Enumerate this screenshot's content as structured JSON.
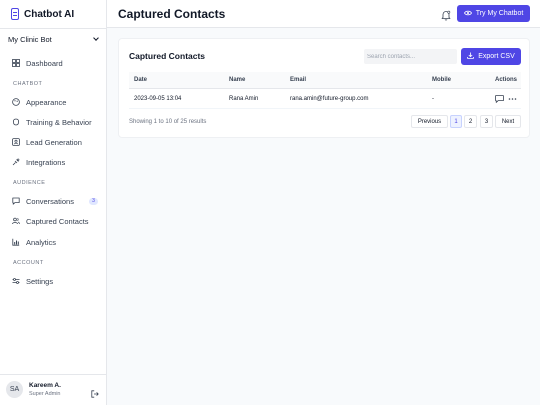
{
  "app": {
    "name": "Chatbot AI"
  },
  "bot_selector": {
    "value": "My Clinic Bot"
  },
  "sidebar": {
    "dashboard": "Dashboard",
    "section_chatbot": "CHATBOT",
    "appearance": "Appearance",
    "training": "Training & Behavior",
    "lead_generation": "Lead Generation",
    "integrations": "Integrations",
    "section_audience": "AUDIENCE",
    "conversations": "Conversations",
    "conversations_badge": "3",
    "captured_contacts": "Captured Contacts",
    "analytics": "Analytics",
    "section_account": "ACCOUNT",
    "settings": "Settings"
  },
  "user": {
    "initials": "SA",
    "name": "Kareem A.",
    "role": "Super Admin"
  },
  "header": {
    "title": "Captured Contacts",
    "try_button": "Try My Chatbot"
  },
  "card": {
    "title": "Captured Contacts",
    "search_placeholder": "Search contacts...",
    "export_button": "Export CSV"
  },
  "table": {
    "columns": {
      "date": "Date",
      "name": "Name",
      "email": "Email",
      "mobile": "Mobile",
      "actions": "Actions"
    },
    "rows": [
      {
        "date": "2023-09-05 13:04",
        "name": "Rana Amin",
        "email": "rana.amin@future-group.com",
        "mobile": "-"
      }
    ]
  },
  "pagination": {
    "summary": "Showing 1 to 10 of 25 results",
    "previous": "Previous",
    "pages": [
      "1",
      "2",
      "3"
    ],
    "next": "Next"
  },
  "colors": {
    "accent": "#4f46e5",
    "sidebar_bg": "#ffffff",
    "page_bg": "#f8fafc"
  }
}
